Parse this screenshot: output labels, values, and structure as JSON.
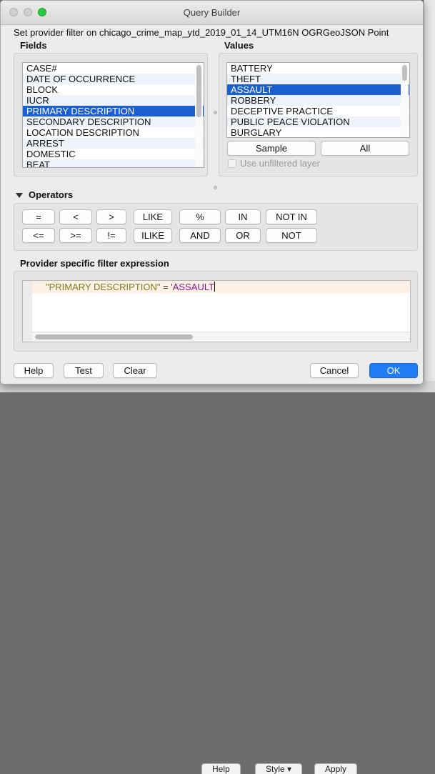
{
  "window": {
    "title": "Query Builder"
  },
  "subtitle": "Set provider filter on chicago_crime_map_ytd_2019_01_14_UTM16N OGRGeoJSON Point",
  "fields": {
    "title": "Fields",
    "items": [
      "CASE#",
      "DATE  OF OCCURRENCE",
      "BLOCK",
      "IUCR",
      "PRIMARY DESCRIPTION",
      "SECONDARY DESCRIPTION",
      "LOCATION DESCRIPTION",
      "ARREST",
      "DOMESTIC",
      "BEAT"
    ],
    "selected": "PRIMARY DESCRIPTION"
  },
  "values": {
    "title": "Values",
    "items": [
      "BATTERY",
      "THEFT",
      "ASSAULT",
      "ROBBERY",
      "DECEPTIVE PRACTICE",
      "PUBLIC PEACE VIOLATION",
      "BURGLARY"
    ],
    "selected": "ASSAULT",
    "sample_label": "Sample",
    "all_label": "All",
    "unfiltered_label": "Use unfiltered layer",
    "unfiltered_checked": false
  },
  "operators": {
    "title": "Operators",
    "row1": [
      "=",
      "<",
      ">",
      "LIKE",
      "%",
      "IN",
      "NOT IN"
    ],
    "row2": [
      "<=",
      ">=",
      "!=",
      "ILIKE",
      "AND",
      "OR",
      "NOT"
    ]
  },
  "expression": {
    "title": "Provider specific filter expression",
    "field_token": "\"PRIMARY DESCRIPTION\"",
    "operator_token": " = ",
    "value_token": "'ASSAULT"
  },
  "footer": {
    "help_label": "Help",
    "test_label": "Test",
    "clear_label": "Clear",
    "cancel_label": "Cancel",
    "ok_label": "OK"
  },
  "background": {
    "help_label": "Help",
    "style_label": "Style ▾",
    "apply_label": "Apply"
  }
}
